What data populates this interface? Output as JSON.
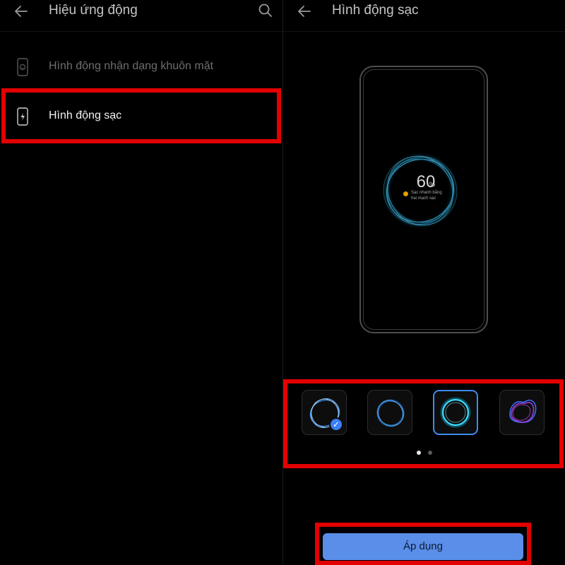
{
  "left_screen": {
    "title": "Hiệu ứng động",
    "items": [
      {
        "label": "Hình động nhận dạng khuôn mặt",
        "icon": "face-recognition-icon",
        "enabled": false
      },
      {
        "label": "Hình động sạc",
        "icon": "charging-phone-icon",
        "enabled": true
      }
    ]
  },
  "right_screen": {
    "title": "Hình động sạc",
    "preview": {
      "percent": "60",
      "percent_unit": "%",
      "subtitle_line1": "Sạc nhanh bằng",
      "subtitle_line2": "hai mạch sạc"
    },
    "animations": [
      {
        "name": "blue-ripple-ring",
        "selected": true
      },
      {
        "name": "dark-blue-ring",
        "selected": false
      },
      {
        "name": "cyan-glow-ring",
        "selected": false
      },
      {
        "name": "purple-wave-ring",
        "selected": false
      }
    ],
    "page_dots": 2,
    "active_page": 1,
    "apply_label": "Áp dụng"
  },
  "colors": {
    "background": "#000000",
    "highlight": "#e30000",
    "apply_button": "#5b8ee8",
    "selection": "#3d8cf0",
    "check_badge": "#3b7ff5"
  }
}
